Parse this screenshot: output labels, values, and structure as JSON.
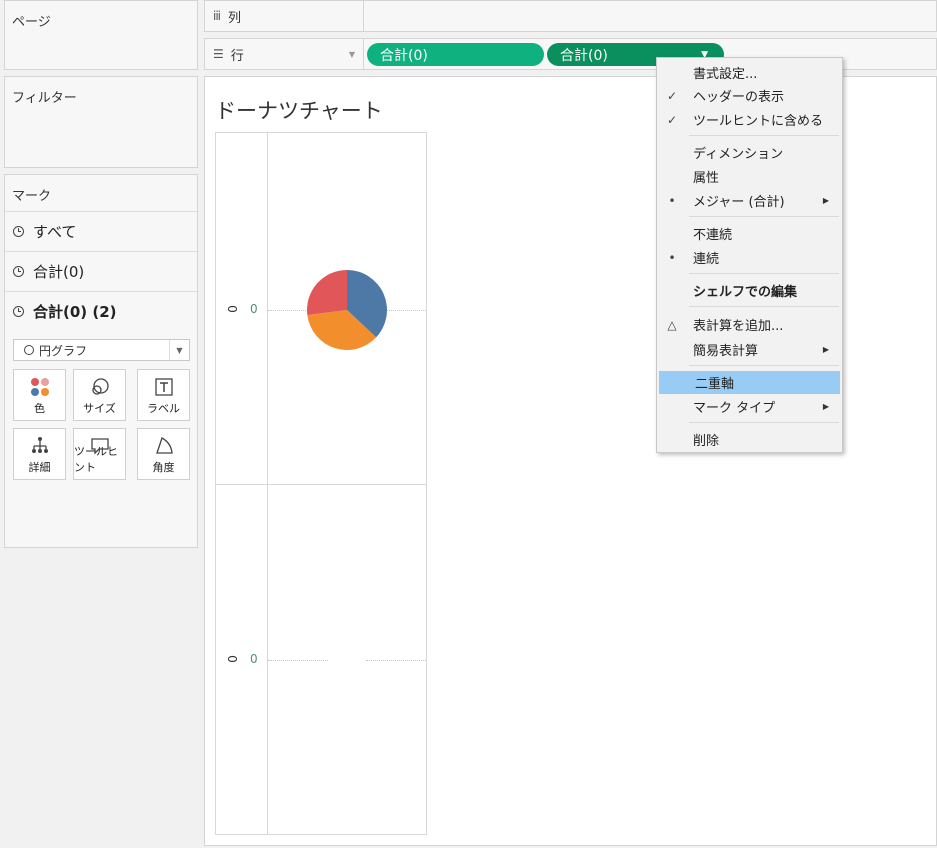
{
  "left_panel": {
    "pages_title": "ページ",
    "filters_title": "フィルター",
    "marks": {
      "title": "マーク",
      "rows": [
        "すべて",
        "合計(0)",
        "合計(0) (2)"
      ],
      "mark_type": "円グラフ",
      "buttons": {
        "color": "色",
        "size": "サイズ",
        "label": "ラベル",
        "detail": "詳細",
        "tooltip": "ツールヒント",
        "angle": "角度"
      }
    }
  },
  "shelves": {
    "columns_label": "列",
    "rows_label": "行",
    "pill1": "合計(0)",
    "pill2": "合計(0)"
  },
  "sheet": {
    "title": "ドーナツチャート",
    "axis_top_value": "0",
    "axis_top_tick": "0",
    "axis_bottom_value": "0",
    "axis_bottom_tick": "0",
    "pie_colors": [
      "#4e79a7",
      "#f28e2b",
      "#e15759"
    ],
    "pie_shares": [
      0.37,
      0.36,
      0.27
    ]
  },
  "menu": {
    "items": {
      "format": "書式設定...",
      "show_header": "ヘッダーの表示",
      "include_tooltip": "ツールヒントに含める",
      "dimension": "ディメンション",
      "attribute": "属性",
      "measure": "メジャー (合計)",
      "discrete": "不連続",
      "continuous": "連続",
      "edit_shelf": "シェルフでの編集",
      "add_table_calc": "表計算を追加...",
      "quick_table_calc": "簡易表計算",
      "dual_axis": "二重軸",
      "mark_type": "マーク タイプ",
      "remove": "削除"
    },
    "highlight_color": "#99ccf5"
  }
}
